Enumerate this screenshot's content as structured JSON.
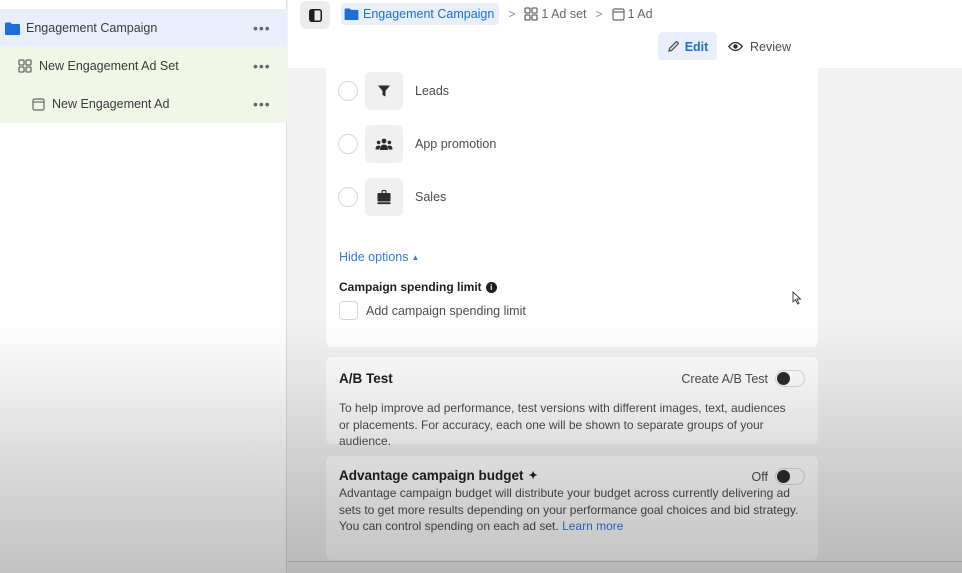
{
  "sidebar": {
    "items": [
      {
        "label": "Engagement Campaign",
        "icon": "folder-icon",
        "more": "•••"
      },
      {
        "label": "New Engagement Ad Set",
        "icon": "grid-icon",
        "more": "•••"
      },
      {
        "label": "New Engagement Ad",
        "icon": "ad-frame-icon",
        "more": "•••"
      }
    ]
  },
  "breadcrumb": {
    "campaign": "Engagement Campaign",
    "adset": "1 Ad set",
    "ad": "1 Ad",
    "separator": ">"
  },
  "mode": {
    "edit_label": "Edit",
    "review_label": "Review",
    "active": "Edit"
  },
  "objectives": [
    {
      "label": "Leads",
      "icon": "funnel-icon",
      "selected": false
    },
    {
      "label": "App promotion",
      "icon": "people-icon",
      "selected": false
    },
    {
      "label": "Sales",
      "icon": "shopping-bag-icon",
      "selected": false
    }
  ],
  "options": {
    "hide_options_label": "Hide options",
    "spending_limit_title": "Campaign spending limit",
    "spending_limit_checkbox_label": "Add campaign spending limit",
    "spending_limit_checked": false
  },
  "ab_test": {
    "title": "A/B Test",
    "toggle_label": "Create A/B Test",
    "enabled": false,
    "description": "To help improve ad performance, test versions with different images, text, audiences or placements. For accuracy, each one will be shown to separate groups of your audience."
  },
  "advantage_budget": {
    "title": "Advantage campaign budget",
    "title_icon": "✦",
    "toggle_label": "Off",
    "enabled": false,
    "description": "Advantage campaign budget will distribute your budget across currently delivering ad sets to get more results depending on your performance goal choices and bid strategy. You can control spending on each ad set.",
    "learn_more": "Learn more"
  },
  "colors": {
    "accent": "#1a6fd8",
    "link": "#3578e5",
    "campaign_highlight": "#e8effb",
    "adset_highlight": "#f1f7e6"
  }
}
